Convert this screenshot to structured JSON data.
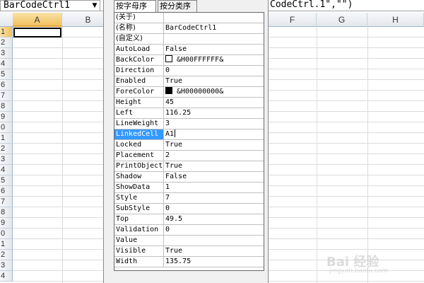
{
  "name_box": {
    "value": "BarCodeCtrl1",
    "dropdown_glyph": "▼"
  },
  "formula_bar": {
    "text": "CodeCtrl.1\",\"\")"
  },
  "columns": [
    "A",
    "B",
    "F",
    "G",
    "H"
  ],
  "rows": [
    "1",
    "2",
    "3",
    "4",
    "5",
    "6",
    "7",
    "8",
    "9",
    "0",
    "1",
    "2",
    "3",
    "4",
    "5",
    "6",
    "7",
    "8",
    "9",
    "0",
    "1",
    "2",
    "3",
    "4"
  ],
  "properties_window": {
    "tabs": {
      "alphabetic": "按字母序",
      "categorized": "按分类序"
    },
    "properties": [
      {
        "name": "(关于)",
        "value": ""
      },
      {
        "name": "(名称)",
        "value": "BarCodeCtrl1"
      },
      {
        "name": "(自定义)",
        "value": ""
      },
      {
        "name": "AutoLoad",
        "value": "False"
      },
      {
        "name": "BackColor",
        "value": "&H00FFFFFF&",
        "swatch": "#ffffff"
      },
      {
        "name": "Direction",
        "value": "0"
      },
      {
        "name": "Enabled",
        "value": "True"
      },
      {
        "name": "ForeColor",
        "value": "&H00000000&",
        "swatch": "#000000"
      },
      {
        "name": "Height",
        "value": "45"
      },
      {
        "name": "Left",
        "value": "116.25"
      },
      {
        "name": "LineWeight",
        "value": "3"
      },
      {
        "name": "LinkedCell",
        "value": "A1",
        "selected": true
      },
      {
        "name": "Locked",
        "value": "True"
      },
      {
        "name": "Placement",
        "value": "2"
      },
      {
        "name": "PrintObject",
        "value": "True"
      },
      {
        "name": "Shadow",
        "value": "False"
      },
      {
        "name": "ShowData",
        "value": "1"
      },
      {
        "name": "Style",
        "value": "7"
      },
      {
        "name": "SubStyle",
        "value": "0"
      },
      {
        "name": "Top",
        "value": "49.5"
      },
      {
        "name": "Validation",
        "value": "0"
      },
      {
        "name": "Value",
        "value": ""
      },
      {
        "name": "Visible",
        "value": "True"
      },
      {
        "name": "Width",
        "value": "135.75"
      }
    ]
  },
  "watermark": {
    "text": "Bai 经验",
    "sub": "jingyan.baidu.com"
  },
  "colors": {
    "selection": "#3399ff",
    "header_active": "#f1c15f",
    "gridline": "#dadcdd"
  }
}
